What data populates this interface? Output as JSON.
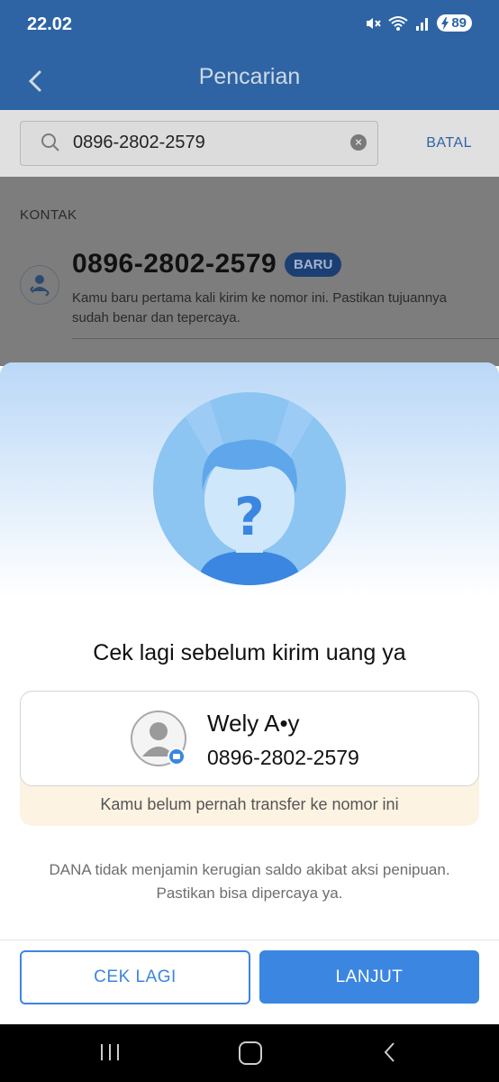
{
  "status_bar": {
    "time": "22.02",
    "battery": "89"
  },
  "app_bar": {
    "title": "Pencarian",
    "back_icon": "chevron-left-icon"
  },
  "search": {
    "value": "0896-2802-2579",
    "cancel_label": "BATAL"
  },
  "contacts": {
    "section_label": "KONTAK",
    "item": {
      "number": "0896-2802-2579",
      "badge": "BARU",
      "description": "Kamu baru pertama kali kirim ke nomor ini. Pastikan tujuannya sudah benar dan tepercaya."
    }
  },
  "sheet": {
    "title": "Cek lagi sebelum kirim uang ya",
    "recipient": {
      "name": "Wely A•y",
      "phone": "0896-2802-2579"
    },
    "note": "Kamu belum pernah transfer ke nomor ini",
    "disclaimer": "DANA tidak menjamin kerugian saldo akibat aksi penipuan. Pastikan bisa dipercaya ya.",
    "secondary_button": "CEK LAGI",
    "primary_button": "LANJUT"
  },
  "colors": {
    "brand": "#2e64a4",
    "accent": "#3b86e0",
    "warning_bg": "#fdf3e3"
  }
}
